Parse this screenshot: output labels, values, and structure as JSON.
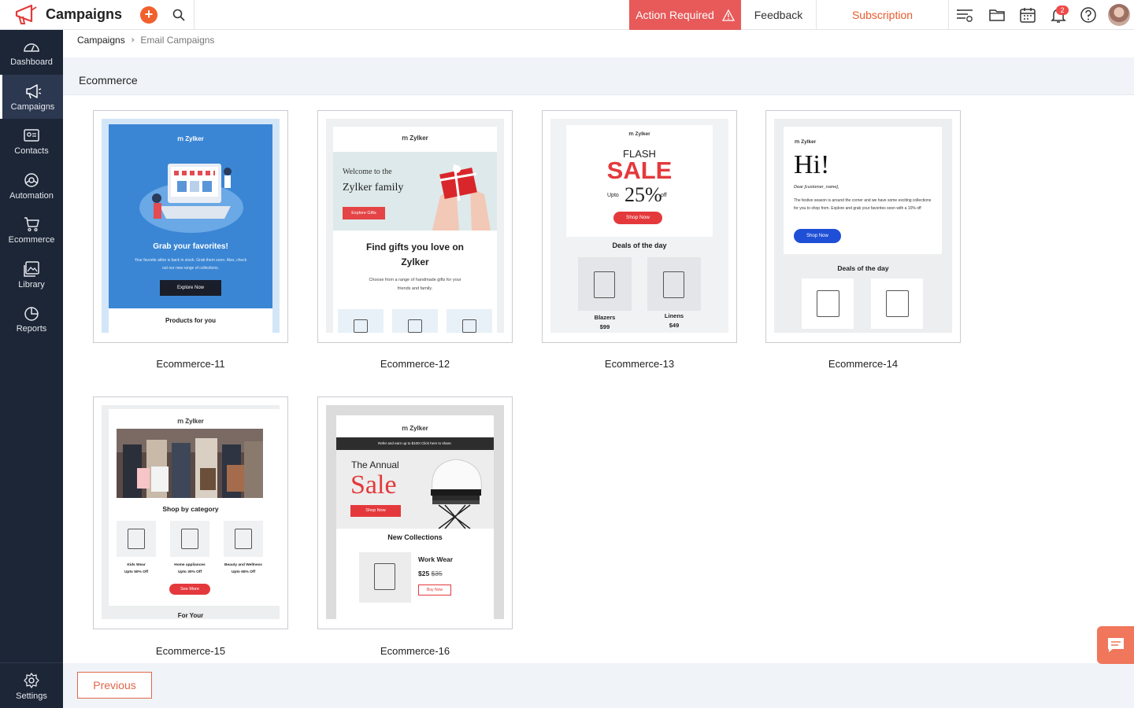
{
  "app": {
    "title": "Campaigns",
    "accent_color": "#f0612e",
    "sidebar_color": "#1c2636"
  },
  "topbar": {
    "add_icon": "plus-icon",
    "search_icon": "search-icon",
    "action_required_label": "Action Required",
    "feedback_label": "Feedback",
    "subscription_label": "Subscription",
    "notification_count": "2",
    "icons": [
      "list-settings-icon",
      "folder-icon",
      "calendar-icon",
      "bell-icon",
      "help-icon",
      "avatar"
    ]
  },
  "sidebar": {
    "items": [
      {
        "label": "Dashboard",
        "icon": "dashboard-icon"
      },
      {
        "label": "Campaigns",
        "icon": "megaphone-icon",
        "active": true
      },
      {
        "label": "Contacts",
        "icon": "contacts-icon"
      },
      {
        "label": "Automation",
        "icon": "automation-icon"
      },
      {
        "label": "Ecommerce",
        "icon": "cart-icon"
      },
      {
        "label": "Library",
        "icon": "library-icon"
      },
      {
        "label": "Reports",
        "icon": "reports-icon"
      }
    ],
    "settings_label": "Settings"
  },
  "breadcrumb": {
    "first": "Campaigns",
    "separator": "›",
    "last": "Email Campaigns"
  },
  "section": {
    "title": "Ecommerce"
  },
  "templates": [
    {
      "name": "Ecommerce-11",
      "brand": "Zylker",
      "headline": "Grab your favorites!",
      "body": "Your favorite attire is back in stock. Grab them soon. Also, check out our new range of collections.",
      "cta": "Explore Now",
      "footer": "Products for you"
    },
    {
      "name": "Ecommerce-12",
      "brand": "Zylker",
      "hero_line1": "Welcome to the",
      "hero_line2": "Zylker family",
      "cta": "Explore Gifts",
      "headline": "Find gifts you love on Zylker",
      "body": "Choose from a range of handmade gifts for your friends and family."
    },
    {
      "name": "Ecommerce-13",
      "brand": "Zylker",
      "flash": "FLASH",
      "sale": "SALE",
      "upto": "Upto",
      "percent": "25%",
      "off": "off",
      "cta": "Shop Now",
      "deals": "Deals of the day",
      "products": [
        {
          "name": "Blazers",
          "price": "$99"
        },
        {
          "name": "Linens",
          "price": "$49"
        }
      ]
    },
    {
      "name": "Ecommerce-14",
      "brand": "Zylker",
      "greeting": "Hi!",
      "dear": "Dear [customer_name],",
      "body": "The festive season is around the corner and we have some exciting collections for you to shop from. Explore and grab your favorites soon with a 10% off",
      "cta": "Shop Now",
      "deals": "Deals of the day"
    },
    {
      "name": "Ecommerce-15",
      "brand": "Zylker",
      "shop_by": "Shop by category",
      "categories": [
        {
          "name": "Kids Wear",
          "offer": "Upto 50% Off"
        },
        {
          "name": "Home appliances",
          "offer": "Upto 30% Off"
        },
        {
          "name": "Beauty and Wellness",
          "offer": "Upto 65% Off"
        }
      ],
      "cta": "See More",
      "footer": "For Your"
    },
    {
      "name": "Ecommerce-16",
      "brand": "Zylker",
      "banner": "Refer and earn up to $100! Click here to share.",
      "annual": "The Annual",
      "sale": "Sale",
      "cta": "Shop Now",
      "new_collections": "New Collections",
      "product_name": "Work Wear",
      "price": "$25",
      "old_price": "$35",
      "buy": "Buy Now"
    }
  ],
  "footer": {
    "previous_label": "Previous"
  },
  "chat_icon": "chat-icon"
}
